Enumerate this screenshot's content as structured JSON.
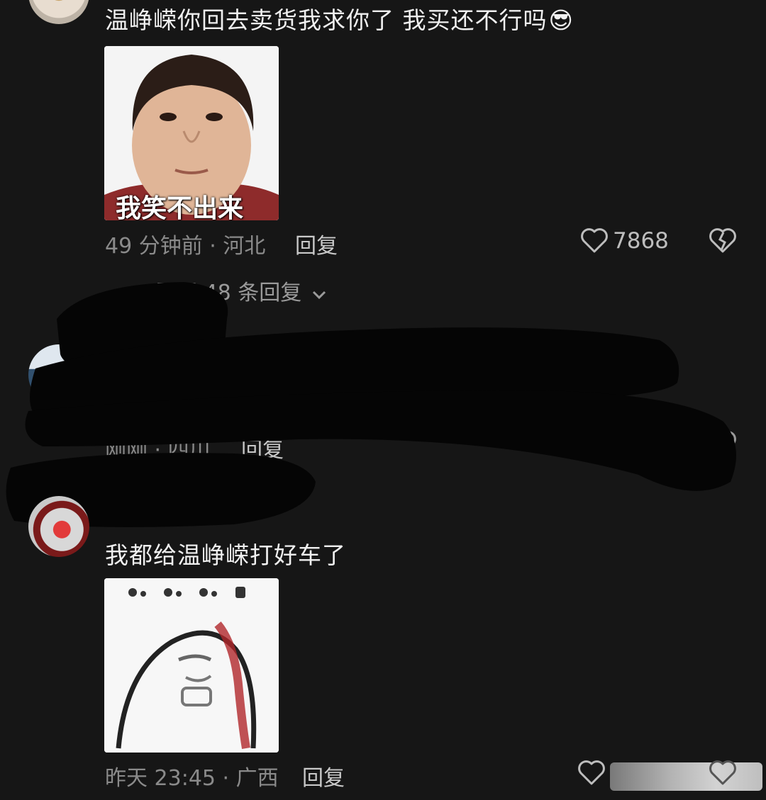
{
  "comments": [
    {
      "text": "温峥嵘你回去卖货我求你了 我买还不行吗",
      "emoji": "😎",
      "sticker_caption": "我笑不出来",
      "time_location": "49 分钟前 · 河北",
      "reply_label": "回复",
      "likes": "7868",
      "expand_replies": "展开 48 条回复"
    },
    {
      "time_location": "刚刚 · 四川",
      "reply_label": "回复"
    },
    {
      "text": "我都给温峥嵘打好车了",
      "time_location": "昨天 23:45 · 广西",
      "reply_label": "回复"
    }
  ],
  "icons": {
    "like": "heart-outline-icon",
    "dislike": "broken-heart-icon",
    "expand": "chevron-down-icon",
    "emoji": "cool-face-emoji"
  }
}
